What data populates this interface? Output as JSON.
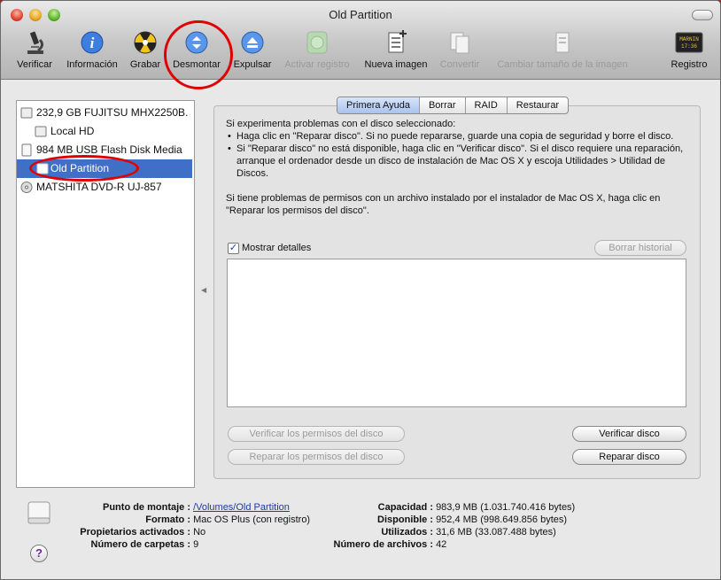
{
  "window": {
    "title": "Old Partition"
  },
  "toolbar": [
    {
      "label": "Verificar",
      "icon": "microscope-icon",
      "enabled": true
    },
    {
      "label": "Información",
      "icon": "info-icon",
      "enabled": true
    },
    {
      "label": "Grabar",
      "icon": "burn-icon",
      "enabled": true
    },
    {
      "label": "Desmontar",
      "icon": "unmount-icon",
      "enabled": true
    },
    {
      "label": "Expulsar",
      "icon": "eject-icon",
      "enabled": true
    },
    {
      "label": "Activar registro",
      "icon": "enable-journaling-icon",
      "enabled": false
    },
    {
      "label": "Nueva imagen",
      "icon": "new-image-icon",
      "enabled": true
    },
    {
      "label": "Convertir",
      "icon": "convert-icon",
      "enabled": false
    },
    {
      "label": "Cambiar tamaño de la imagen",
      "icon": "resize-image-icon",
      "enabled": false
    },
    {
      "label": "Registro",
      "icon": "log-icon",
      "enabled": true
    }
  ],
  "sidebar": {
    "items": [
      {
        "label": "232,9 GB FUJITSU MHX2250B.",
        "icon": "hard-disk-icon"
      },
      {
        "label": "Local HD",
        "icon": "volume-icon"
      },
      {
        "label": "984 MB USB Flash Disk Media",
        "icon": "usb-disk-icon"
      },
      {
        "label": "Old Partition",
        "icon": "volume-icon",
        "selected": true
      },
      {
        "label": "MATSHITA DVD-R UJ-857",
        "icon": "optical-drive-icon"
      }
    ]
  },
  "tabs": [
    {
      "label": "Primera Ayuda",
      "active": true
    },
    {
      "label": "Borrar"
    },
    {
      "label": "RAID"
    },
    {
      "label": "Restaurar"
    }
  ],
  "first_aid": {
    "intro": "Si experimenta problemas con el disco seleccionado:",
    "bullet1": "Haga clic en \"Reparar disco\". Si no puede repararse, guarde una copia de seguridad y borre el disco.",
    "bullet2": "Si \"Reparar disco\" no está disponible, haga clic en \"Verificar disco\". Si el disco requiere una reparación, arranque el ordenador desde un disco de instalación de Mac OS X y escoja Utilidades > Utilidad de Discos.",
    "permissions": "Si tiene problemas de permisos con un archivo instalado por el instalador de Mac OS X, haga clic en \"Reparar los permisos del disco\".",
    "show_details_label": "Mostrar detalles",
    "show_details_checked": true,
    "clear_history": "Borrar historial",
    "verify_permissions": "Verificar los permisos del disco",
    "repair_permissions": "Reparar los permisos del disco",
    "verify_disk": "Verificar disco",
    "repair_disk": "Reparar disco"
  },
  "details": {
    "mount_point_label": "Punto de montaje :",
    "mount_point": "/Volumes/Old Partition",
    "format_label": "Formato :",
    "format": "Mac OS Plus (con registro)",
    "owners_label": "Propietarios activados :",
    "owners": "No",
    "folders_label": "Número de carpetas :",
    "folders": "9",
    "capacity_label": "Capacidad :",
    "capacity": "983,9 MB (1.031.740.416 bytes)",
    "available_label": "Disponible :",
    "available": "952,4 MB (998.649.856 bytes)",
    "used_label": "Utilizados :",
    "used": "31,6 MB (33.087.488 bytes)",
    "files_label": "Número de archivos :",
    "files": "42"
  },
  "help": "?",
  "log_icon_text": "MARNIN\n17:36",
  "colors": {
    "selection": "#3f6fc6",
    "annotation": "#e00000",
    "desktop": "#8a2a2a"
  }
}
